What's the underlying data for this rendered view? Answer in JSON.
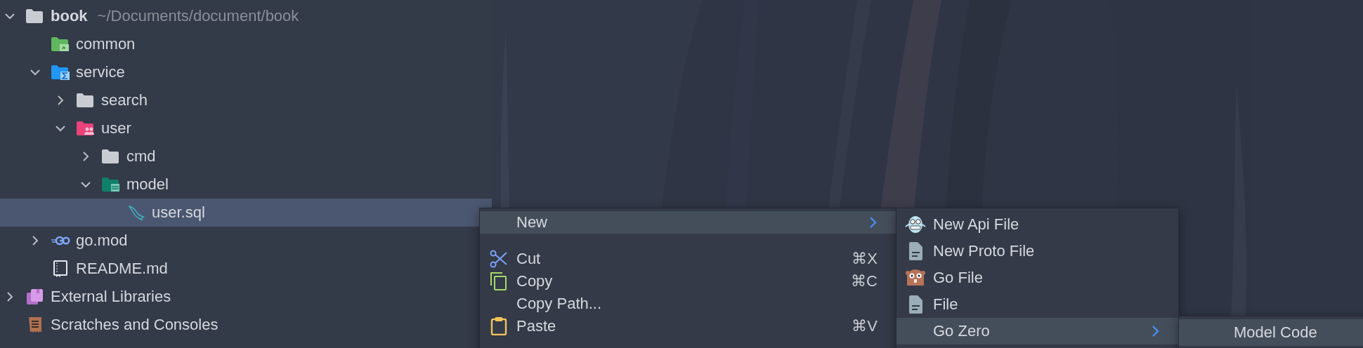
{
  "tree": [
    {
      "label": "book",
      "path": "~/Documents/document/book",
      "kind": "folder",
      "expanded": true,
      "selected": false,
      "children": [
        {
          "label": "common",
          "kind": "shared-folder",
          "selected": false
        },
        {
          "label": "service",
          "kind": "source-folder",
          "expanded": true,
          "selected": false,
          "children": [
            {
              "label": "search",
              "kind": "folder",
              "expanded": false,
              "selected": false
            },
            {
              "label": "user",
              "kind": "people-folder",
              "expanded": true,
              "selected": false,
              "children": [
                {
                  "label": "cmd",
                  "kind": "folder",
                  "expanded": false,
                  "selected": false
                },
                {
                  "label": "model",
                  "kind": "data-folder",
                  "expanded": true,
                  "selected": false,
                  "children": [
                    {
                      "label": "user.sql",
                      "kind": "sql-file",
                      "selected": true
                    }
                  ]
                }
              ]
            }
          ]
        },
        {
          "label": "go.mod",
          "kind": "go-file",
          "expanded": false,
          "selected": false
        },
        {
          "label": "README.md",
          "kind": "readme-file",
          "selected": false
        }
      ]
    },
    {
      "label": "External Libraries",
      "kind": "library",
      "expanded": false,
      "selected": false
    },
    {
      "label": "Scratches and Consoles",
      "kind": "scratch",
      "selected": false
    }
  ],
  "context_menu": {
    "items": [
      {
        "kind": "item",
        "label": "New",
        "submenu": true,
        "selected": true
      },
      {
        "kind": "separator"
      },
      {
        "kind": "item",
        "label": "Cut",
        "shortcut": "⌘X",
        "selected": false
      },
      {
        "kind": "item",
        "label": "Copy",
        "shortcut": "⌘C",
        "selected": false
      },
      {
        "kind": "item",
        "label": "Copy Path...",
        "selected": false
      },
      {
        "kind": "item",
        "label": "Paste",
        "shortcut": "⌘V",
        "selected": false
      }
    ]
  },
  "new_submenu": {
    "items": [
      {
        "kind": "item",
        "label": "New Api File",
        "selected": false
      },
      {
        "kind": "item",
        "label": "New Proto File",
        "selected": false
      },
      {
        "kind": "item",
        "label": "Go File",
        "selected": false
      },
      {
        "kind": "item",
        "label": "File",
        "selected": false
      },
      {
        "kind": "item",
        "label": "Go Zero",
        "submenu": true,
        "selected": true
      }
    ]
  },
  "go_zero_submenu": {
    "items": [
      {
        "kind": "item",
        "label": "Model Code",
        "selected": true
      }
    ]
  }
}
